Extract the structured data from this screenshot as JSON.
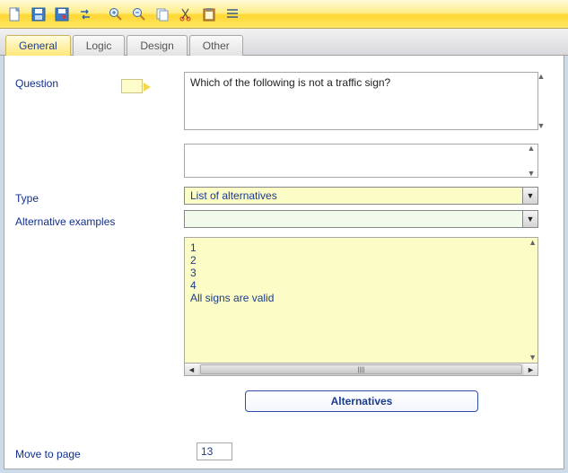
{
  "toolbar": {
    "icons": [
      "new",
      "save",
      "export",
      "swap",
      "zoom-in",
      "zoom-out",
      "copy",
      "cut",
      "paste",
      "list"
    ]
  },
  "tabs": [
    {
      "label": "General",
      "active": true
    },
    {
      "label": "Logic",
      "active": false
    },
    {
      "label": "Design",
      "active": false
    },
    {
      "label": "Other",
      "active": false
    }
  ],
  "labels": {
    "question": "Question",
    "type": "Type",
    "alt_examples": "Alternative examples",
    "move_to_page": "Move to page",
    "alternatives_btn": "Alternatives"
  },
  "fields": {
    "question_text": "Which of the following is not a traffic sign?",
    "sub_text": "",
    "type_value": "List of alternatives",
    "alt_example_value": "",
    "alternatives_list": "1\n2\n3\n4\nAll signs are valid",
    "page_number": "13"
  }
}
